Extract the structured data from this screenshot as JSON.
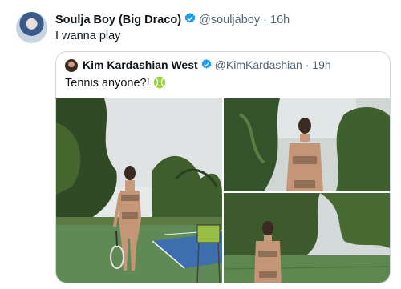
{
  "tweet": {
    "author_name": "Soulja Boy (Big Draco)",
    "handle": "@souljaboy",
    "separator": "·",
    "time": "16h",
    "text": "I wanna play"
  },
  "quote": {
    "author_name": "Kim Kardashian West",
    "handle": "@KimKardashian",
    "separator": "·",
    "time": "19h",
    "text": "Tennis anyone?!"
  },
  "colors": {
    "verified": "#1d9bf0",
    "secondary_text": "#536471",
    "border": "#cfd9de"
  },
  "icons": {
    "verified": "verified-badge-icon",
    "tennis": "tennis-ball-emoji"
  }
}
